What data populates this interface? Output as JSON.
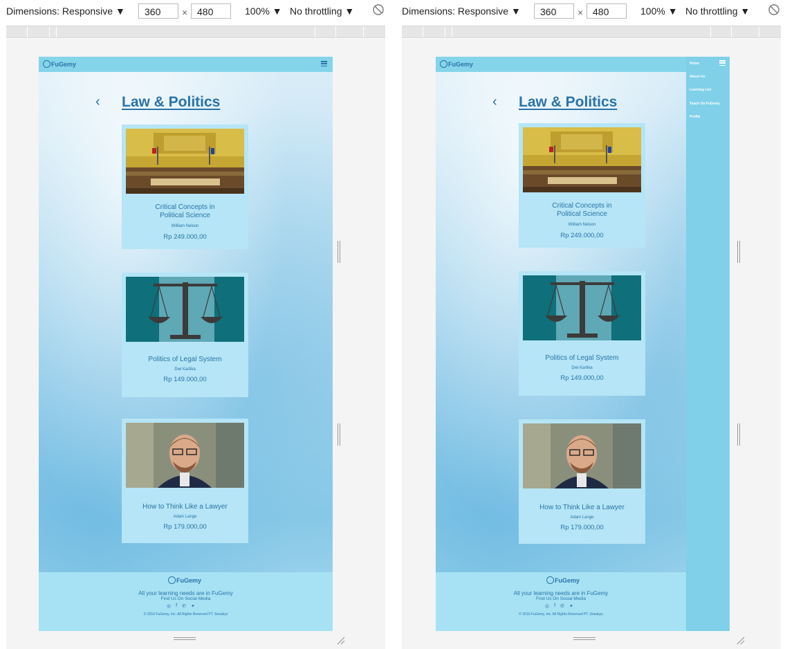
{
  "toolbar": {
    "dimensions_label": "Dimensions: Responsive ▼",
    "width": "360",
    "times": "×",
    "height": "480",
    "zoom": "100% ▼",
    "throttle": "No throttling ▼"
  },
  "site": {
    "brand": "FuGemy",
    "page_title": "Law & Politics",
    "products": [
      {
        "title_line1": "Critical Concepts in",
        "title_line2": "Political Science",
        "author": "William Nelson",
        "price": "Rp 249.000,00"
      },
      {
        "title_line1": "Politics of Legal System",
        "title_line2": "",
        "author": "Dwi Kartika",
        "price": "Rp 149.000,00"
      },
      {
        "title_line1": "How to Think Like a Lawyer",
        "title_line2": "",
        "author": "Adam Lange",
        "price": "Rp 179.000,00"
      }
    ],
    "footer": {
      "tagline": "All your learning needs are in FuGemy",
      "social": "Find Us On Social Media",
      "copyright": "© 2010 FuGemy, Inc. All Rights Reserved PT. Sneakys"
    },
    "menu": [
      "Home",
      "About Us",
      "Learning List",
      "Teach On FuGemy",
      "Profile"
    ]
  },
  "colors": {
    "navbar": "#84d4ea",
    "accent_text": "#2a73a8",
    "card_bg": "#b5e5f6",
    "footer_bg": "#a6e2f4",
    "side_menu": "#7fd0e8"
  }
}
